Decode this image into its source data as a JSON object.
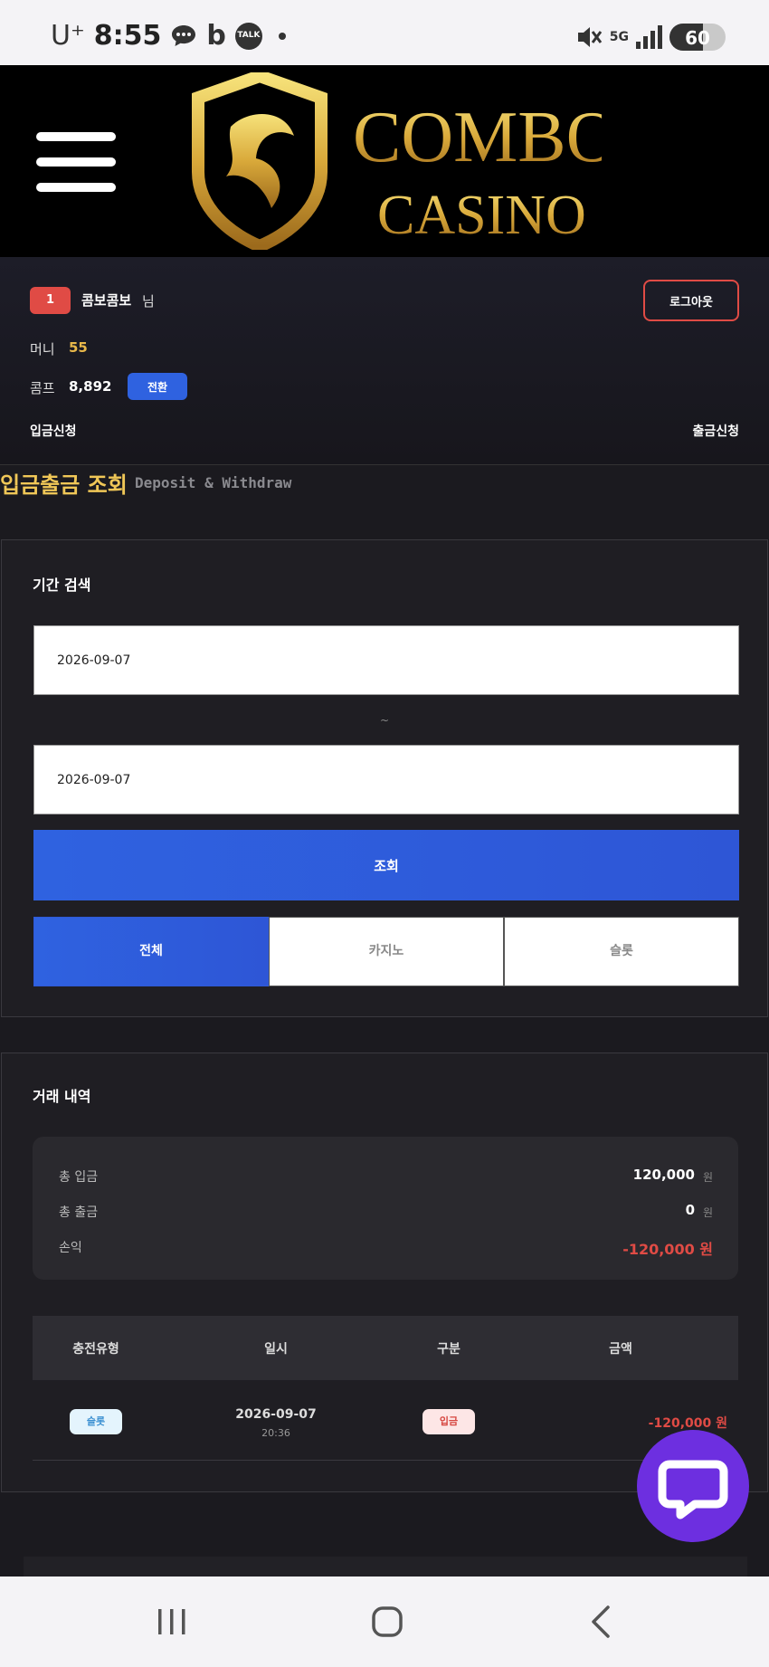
{
  "status_bar": {
    "carrier": "U⁺",
    "time": "8:55",
    "icons": [
      "chat-bubble-icon",
      "b-app-icon",
      "kakaotalk-icon",
      "dot-icon"
    ],
    "talk_label": "TALK",
    "b_label": "b",
    "network": "5G",
    "battery": "60",
    "battery_level": 0.6,
    "right_icons": [
      "mute-icon",
      "signal-icon",
      "battery-charging-icon"
    ]
  },
  "header": {
    "logo_line1": "COMBO",
    "logo_line2": "CASINO",
    "menu_icon": "hamburger-menu-icon"
  },
  "user": {
    "level": "1",
    "name": "콤보콤보",
    "honorific": "님",
    "logout_label": "로그아웃",
    "money_label": "머니",
    "money_value": "55",
    "comp_label": "콤프",
    "comp_value": "8,892",
    "convert_label": "전환",
    "deposit_request": "입금신청",
    "withdraw_request": "출금신청"
  },
  "page": {
    "title": "입금출금 조회",
    "subtitle": "Deposit & Withdraw"
  },
  "search": {
    "section_title": "기간 검색",
    "start_date": "2026-09-07",
    "separator": "~",
    "end_date": "2026-09-07",
    "button_label": "조회",
    "tabs": [
      "전체",
      "카지노",
      "슬롯"
    ],
    "active_tab": "전체"
  },
  "history": {
    "section_title": "거래 내역",
    "summary": {
      "total_deposit_label": "총 입금",
      "total_deposit_value": "120,000",
      "total_withdraw_label": "총 출금",
      "total_withdraw_value": "0",
      "unit": "원",
      "profit_label": "손익",
      "profit_value": "-120,000 원"
    },
    "columns": [
      "충전유형",
      "일시",
      "구분",
      "금액"
    ],
    "rows": [
      {
        "type": "슬롯",
        "date": "2026-09-07",
        "time": "20:36",
        "category": "입금",
        "amount": "-120,000 원"
      }
    ]
  },
  "colors": {
    "accent_blue": "#2f62e0",
    "gold": "#f0c757",
    "red": "#e04b45",
    "chat_purple": "#6d2fe0"
  },
  "nav": {
    "icons": [
      "recent-apps-icon",
      "home-icon",
      "back-icon"
    ]
  }
}
